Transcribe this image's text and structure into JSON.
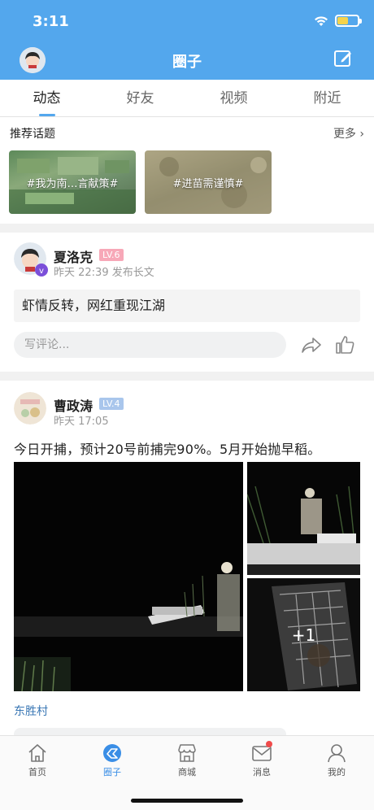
{
  "status": {
    "time": "3:11"
  },
  "header": {
    "title": "圈子"
  },
  "tabs": [
    "动态",
    "好友",
    "视频",
    "附近"
  ],
  "topics": {
    "title": "推荐话题",
    "more": "更多 ›",
    "items": [
      "#我为南…言献策#",
      "#进苗需谨慎#"
    ]
  },
  "post1": {
    "name": "夏洛克",
    "level": "LV.6",
    "meta": "昨天 22:39  发布长文",
    "title": "虾情反转，网红重现江湖",
    "comment_placeholder": "写评论..."
  },
  "post2": {
    "name": "曹政涛",
    "level": "LV.4",
    "meta": "昨天 17:05",
    "body": "今日开捕，预计20号前捕完90%。5月开始抛早稻。",
    "more_images": "+1",
    "location": "东胜村"
  },
  "nav": [
    {
      "label": "首页",
      "icon": "home-icon"
    },
    {
      "label": "圈子",
      "icon": "circle-icon"
    },
    {
      "label": "商城",
      "icon": "shop-icon"
    },
    {
      "label": "消息",
      "icon": "message-icon"
    },
    {
      "label": "我的",
      "icon": "profile-icon"
    }
  ],
  "colors": {
    "accent": "#53a7ed",
    "link": "#3b78b5",
    "badge": "#f04b4b"
  }
}
